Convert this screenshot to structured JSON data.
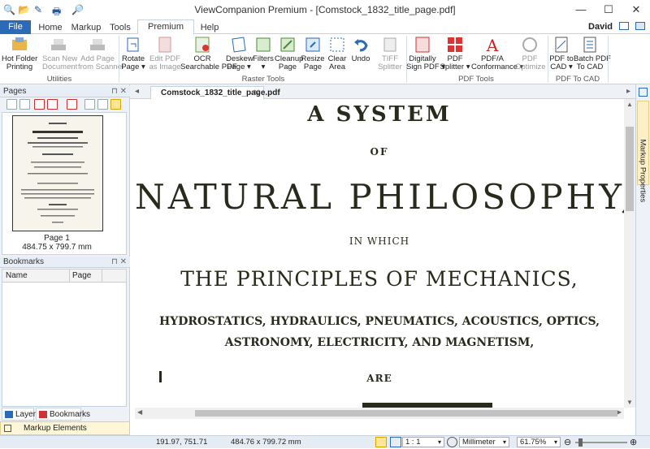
{
  "titlebar": {
    "title": "ViewCompanion Premium - [Comstock_1832_title_page.pdf]",
    "minimize": "—",
    "maximize": "☐",
    "close": "✕"
  },
  "tabs": {
    "file": "File",
    "home": "Home",
    "markup": "Markup",
    "tools": "Tools",
    "premium": "Premium Tools",
    "help": "Help",
    "user": "David"
  },
  "ribbon": {
    "hotfolder": "Hot Folder\nPrinting",
    "scan_new": "Scan New\nDocument",
    "add_page": "Add Page\nfrom Scanner",
    "group_utilities": "Utilities",
    "rotate": "Rotate\nPage ▾",
    "edit_pdf": "Edit PDF\nas Image",
    "ocr": "OCR\nSearchable PDF",
    "deskew": "Deskew\nPage ▾",
    "filters": "Filters\n▾",
    "cleanup": "Cleanup\nPage",
    "resize": "Resize\nPage",
    "clear_area": "Clear\nArea",
    "undo": "Undo",
    "tiff": "TIFF\nSplitter",
    "group_raster": "Raster Tools",
    "sign": "Digitally\nSign PDF ▾",
    "splitter": "PDF\nSplitter ▾",
    "pdfa": "PDF/A\nConformance ▾",
    "optimize": "PDF\nOptimize",
    "group_pdf": "PDF Tools",
    "pdf_cad": "PDF to\nCAD ▾",
    "batch_cad": "Batch PDF\nTo CAD",
    "group_cad": "PDF To CAD"
  },
  "pages_panel": {
    "title": "Pages",
    "page_label": "Page 1",
    "page_size": "484.75 x 799.7 mm"
  },
  "bookmarks_panel": {
    "title": "Bookmarks",
    "col_name": "Name",
    "col_page": "Page"
  },
  "left_tabs": {
    "layers": "Layers",
    "bookmarks": "Bookmarks",
    "markup_elements": "Markup Elements"
  },
  "doc": {
    "tab_name": "Comstock_1832_title_page.pdf",
    "line1": "A SYSTEM",
    "line2": "OF",
    "line3": "NATURAL PHILOSOPHY;",
    "line4": "IN WHICH",
    "line5": "THE PRINCIPLES OF MECHANICS,",
    "line6": "HYDROSTATICS, HYDRAULICS, PNEUMATICS, ACOUSTICS, OPTICS,",
    "line7": "ASTRONOMY, ELECTRICITY, AND MAGNETISM,",
    "line8": "ARE"
  },
  "right_dock": {
    "markup_properties": "Markup Properties"
  },
  "status": {
    "coords": "191.97, 751.71",
    "size": "484.76 x 799.72 mm",
    "scale": "1 : 1",
    "units": "Millimeter",
    "zoom": "61.75%"
  },
  "colors": {
    "file_tab": "#2a6ab7",
    "ribbon_border": "#c5d2e0",
    "markup_highlight": "#fdf6d8"
  }
}
